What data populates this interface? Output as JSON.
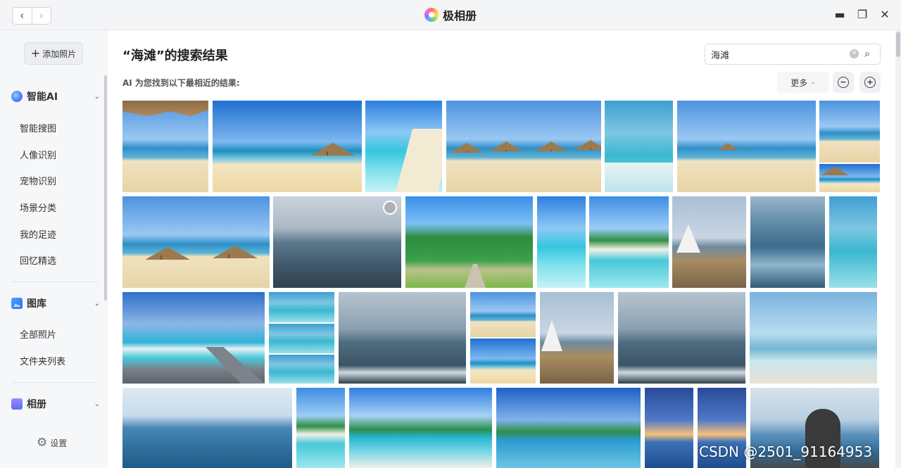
{
  "window": {
    "title": "极相册",
    "controls": [
      "minimize-icon",
      "restore-icon",
      "close-icon"
    ],
    "nav": {
      "back": "‹",
      "forward": "›"
    }
  },
  "sidebar": {
    "add_button": "添加照片",
    "sections": [
      {
        "label": "智能AI",
        "icon": "ai-sparkle-icon",
        "items": [
          "智能搜图",
          "人像识别",
          "宠物识别",
          "场景分类",
          "我的足迹",
          "回忆精选"
        ]
      },
      {
        "label": "图库",
        "icon": "gallery-icon",
        "items": [
          "全部照片",
          "文件夹列表"
        ]
      },
      {
        "label": "相册",
        "icon": "album-icon",
        "items": []
      }
    ],
    "settings_label": "设置"
  },
  "main": {
    "title": "“海滩”的搜索结果",
    "subtitle": "AI 为您找到以下最相近的结果:",
    "search": {
      "value": "海滩",
      "placeholder": ""
    },
    "more_label": "更多",
    "zoom_out": "−",
    "zoom_in": "+"
  },
  "watermark": "CSDN @2501_91164953"
}
